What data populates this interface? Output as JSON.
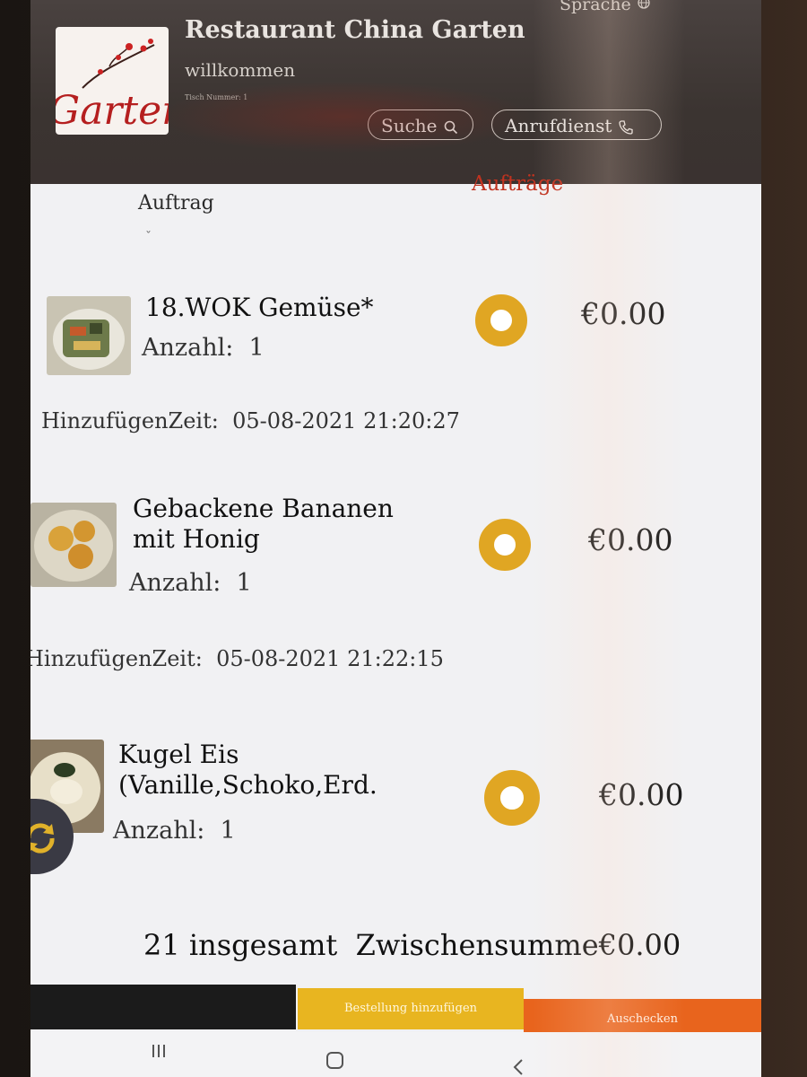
{
  "header": {
    "restaurant_name": "Restaurant China Garten",
    "language_label": "Sprache",
    "welcome": "willkommen",
    "table_number": "Tisch Nummer: 1",
    "search_label": "Suche",
    "call_service_label": "Anrufdienst",
    "logo_text": "Garten"
  },
  "tabs": {
    "order": "Auftrag",
    "orders": "Aufträge"
  },
  "items": [
    {
      "name": "18.WOK Gemüse*",
      "quantity_label": "Anzahl:",
      "quantity": "1",
      "price": "€0.00",
      "added_time_label": "HinzufügenZeit:",
      "added_time": "05-08-2021 21:20:27"
    },
    {
      "name_line1": "Gebackene Bananen",
      "name_line2": "mit Honig",
      "quantity_label": "Anzahl:",
      "quantity": "1",
      "price": "€0.00",
      "added_time_label": "HinzufügenZeit:",
      "added_time": "05-08-2021 21:22:15"
    },
    {
      "name_line1": "Kugel Eis",
      "name_line2": "(Vanille,Schoko,Erd.",
      "quantity_label": "Anzahl:",
      "quantity": "1",
      "price": "€0.00"
    }
  ],
  "summary": {
    "total_count": "21",
    "total_label": "insgesamt",
    "subtotal_label": "Zwischensumme",
    "subtotal_value": "€0.00"
  },
  "bottom_bar": {
    "add_order": "Bestellung hinzufügen",
    "checkout": "Auschecken"
  },
  "colors": {
    "accent_red": "#c0321f",
    "radio_gold": "#e0a623",
    "add_button": "#e8b520",
    "checkout_button": "#e8641d"
  },
  "icons": [
    "search-icon",
    "phone-icon",
    "globe-icon",
    "refresh-icon",
    "recent-apps-icon",
    "home-icon",
    "back-icon"
  ]
}
